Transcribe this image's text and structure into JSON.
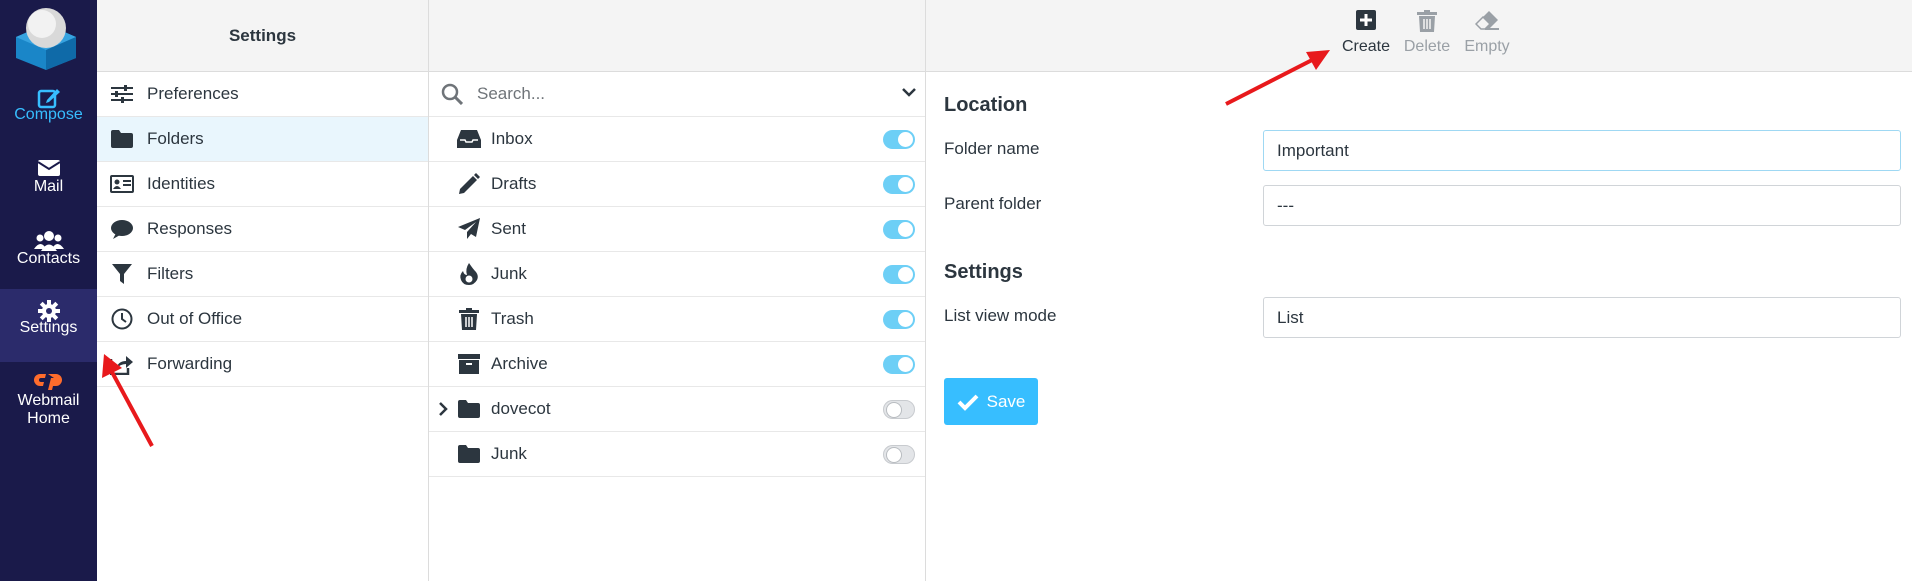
{
  "nav": {
    "compose": "Compose",
    "mail": "Mail",
    "contacts": "Contacts",
    "settings": "Settings",
    "webmail_line1": "Webmail",
    "webmail_line2": "Home"
  },
  "settings_column": {
    "title": "Settings",
    "items": [
      {
        "label": "Preferences",
        "icon": "sliders-icon"
      },
      {
        "label": "Folders",
        "icon": "folder-icon",
        "active": true
      },
      {
        "label": "Identities",
        "icon": "id-card-icon"
      },
      {
        "label": "Responses",
        "icon": "comment-icon"
      },
      {
        "label": "Filters",
        "icon": "filter-icon"
      },
      {
        "label": "Out of Office",
        "icon": "clock-icon"
      },
      {
        "label": "Forwarding",
        "icon": "share-icon"
      }
    ]
  },
  "folders_column": {
    "search_placeholder": "Search...",
    "folders": [
      {
        "label": "Inbox",
        "icon": "inbox-icon",
        "subscribed": true
      },
      {
        "label": "Drafts",
        "icon": "pencil-icon",
        "subscribed": true
      },
      {
        "label": "Sent",
        "icon": "paper-plane-icon",
        "subscribed": true
      },
      {
        "label": "Junk",
        "icon": "fire-icon",
        "subscribed": true
      },
      {
        "label": "Trash",
        "icon": "trash-icon",
        "subscribed": true
      },
      {
        "label": "Archive",
        "icon": "archive-icon",
        "subscribed": true
      },
      {
        "label": "dovecot",
        "icon": "folder-icon",
        "subscribed": false,
        "expandable": true
      },
      {
        "label": "Junk",
        "icon": "folder-icon",
        "subscribed": false
      }
    ]
  },
  "toolbar": {
    "create": "Create",
    "delete": "Delete",
    "empty": "Empty"
  },
  "form": {
    "location_title": "Location",
    "folder_name_label": "Folder name",
    "folder_name_value": "Important",
    "parent_folder_label": "Parent folder",
    "parent_folder_value": "---",
    "settings_title": "Settings",
    "list_view_label": "List view mode",
    "list_view_value": "List",
    "save": "Save"
  },
  "colors": {
    "nav_bg": "#1a1a4a",
    "accent": "#37beff",
    "cpanel_orange": "#ff6c2c",
    "arrow_red": "#e8191c"
  }
}
